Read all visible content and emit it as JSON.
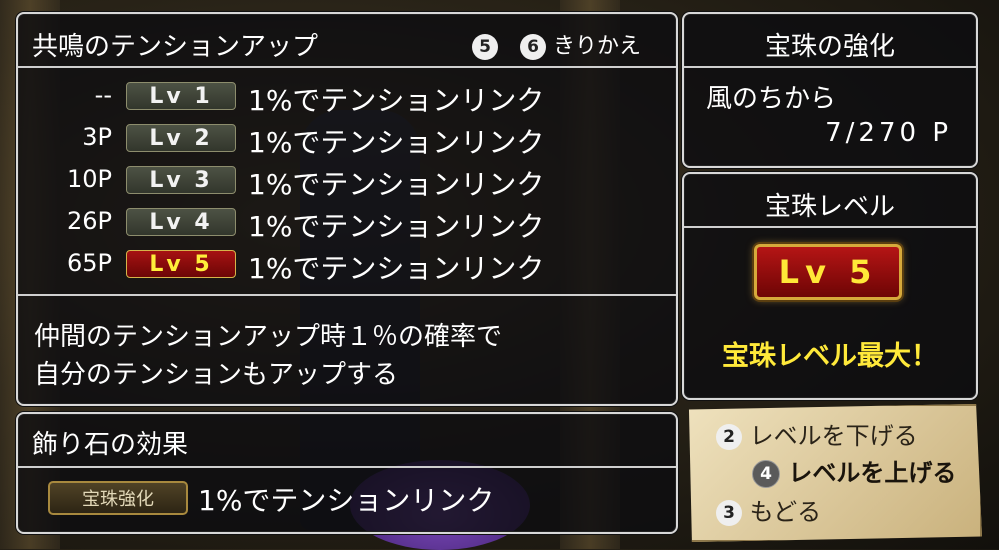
{
  "resonance_panel": {
    "title": "共鳴のテンションアップ",
    "switch": {
      "btn_a": "5",
      "btn_b": "6",
      "label": "きりかえ"
    },
    "rows": [
      {
        "cost": "--",
        "level": "Lv 1",
        "effect": "1%でテンションリンク",
        "active": false
      },
      {
        "cost": "3P",
        "level": "Lv 2",
        "effect": "1%でテンションリンク",
        "active": false
      },
      {
        "cost": "10P",
        "level": "Lv 3",
        "effect": "1%でテンションリンク",
        "active": false
      },
      {
        "cost": "26P",
        "level": "Lv 4",
        "effect": "1%でテンションリンク",
        "active": false
      },
      {
        "cost": "65P",
        "level": "Lv 5",
        "effect": "1%でテンションリンク",
        "active": true
      }
    ],
    "description_line1": "仲間のテンションアップ時１％の確率で",
    "description_line2": "自分のテンションもアップする"
  },
  "ornament_panel": {
    "title": "飾り石の効果",
    "badge": "宝珠強化",
    "effect": "1%でテンションリンク"
  },
  "enhance_panel": {
    "title": "宝珠の強化",
    "power_label": "風のちから",
    "points": "7/270 P"
  },
  "level_panel": {
    "title": "宝珠レベル",
    "level": "Lv 5",
    "status": "宝珠レベル最大！"
  },
  "command_menu": {
    "items": [
      {
        "button": "2",
        "label": "レベルを下げる",
        "selected": false
      },
      {
        "button": "4",
        "label": "レベルを上げる",
        "selected": true
      },
      {
        "button": "3",
        "label": "もどる",
        "selected": false
      }
    ]
  },
  "colors": {
    "active_level_bg": "#8a0b0b",
    "active_level_text": "#ffee3a",
    "status_text": "#ffe93a",
    "panel_border": "#d8d8d8"
  }
}
